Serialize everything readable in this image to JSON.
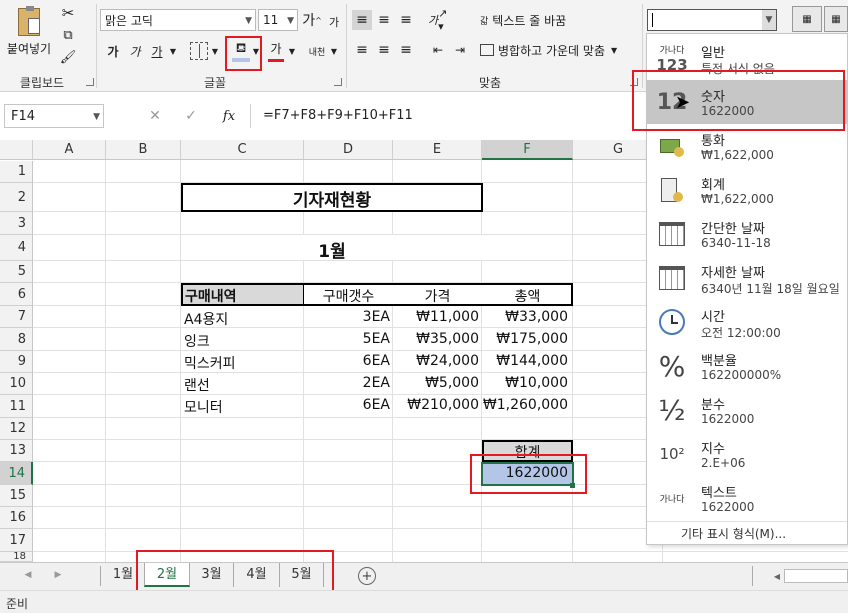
{
  "ribbon": {
    "clipboard": {
      "paste_label": "붙여넣기",
      "group_label": "클립보드"
    },
    "font": {
      "font_name": "맑은 고딕",
      "font_size": "11",
      "grow_label": "가",
      "shrink_label": "가",
      "bold_label": "가",
      "italic_label": "가",
      "underline_label": "가",
      "font_color_label": "가",
      "phonetic_label": "내천",
      "group_label": "글꼴"
    },
    "align": {
      "wrap_label": "텍스트 줄 바꿈",
      "wrap_glyph": "갋",
      "merge_label": "병합하고 가운데 맞춤",
      "orient_label": "가",
      "group_label": "맞춤"
    },
    "number": {
      "format_value": ""
    }
  },
  "formula_bar": {
    "name_box": "F14",
    "cancel": "✕",
    "enter": "✓",
    "fx": "fx",
    "formula": "=F7+F8+F9+F10+F11"
  },
  "columns": [
    "A",
    "B",
    "C",
    "D",
    "E",
    "F",
    "G"
  ],
  "rows": [
    "1",
    "2",
    "3",
    "4",
    "5",
    "6",
    "7",
    "8",
    "9",
    "10",
    "11",
    "12",
    "13",
    "14",
    "15",
    "16",
    "17",
    "18"
  ],
  "sheet": {
    "title": "기자재현황",
    "month": "1월",
    "headers": [
      "구매내역",
      "구매갯수",
      "가격",
      "총액"
    ],
    "items": [
      {
        "name": "A4용지",
        "qty": "3EA",
        "price": "₩11,000",
        "total": "₩33,000"
      },
      {
        "name": "잉크",
        "qty": "5EA",
        "price": "₩35,000",
        "total": "₩175,000"
      },
      {
        "name": "믹스커피",
        "qty": "6EA",
        "price": "₩24,000",
        "total": "₩144,000"
      },
      {
        "name": "랜선",
        "qty": "2EA",
        "price": "₩5,000",
        "total": "₩10,000"
      },
      {
        "name": "모니터",
        "qty": "6EA",
        "price": "₩210,000",
        "total": "₩1,260,000"
      }
    ],
    "sum_label": "합계",
    "sum_value": "1622000"
  },
  "number_format_menu": {
    "items": [
      {
        "title": "일반",
        "sub": "특정 서식 없음",
        "icon": "general-icon",
        "glyph_top": "가나다",
        "glyph_bottom": "123"
      },
      {
        "title": "숫자",
        "sub": "1622000",
        "icon": "number-icon",
        "glyph": "12"
      },
      {
        "title": "통화",
        "sub": "₩1,622,000",
        "icon": "currency-icon"
      },
      {
        "title": "회계",
        "sub": "₩1,622,000",
        "icon": "accounting-icon"
      },
      {
        "title": "간단한 날짜",
        "sub": "6340-11-18",
        "icon": "calendar-short-icon"
      },
      {
        "title": "자세한 날짜",
        "sub": "6340년 11월 18일 월요일",
        "icon": "calendar-long-icon"
      },
      {
        "title": "시간",
        "sub": "오전 12:00:00",
        "icon": "clock-icon"
      },
      {
        "title": "백분율",
        "sub": "162200000%",
        "icon": "percent-icon",
        "glyph": "%"
      },
      {
        "title": "분수",
        "sub": "1622000",
        "icon": "fraction-icon",
        "glyph": "½"
      },
      {
        "title": "지수",
        "sub": "2.E+06",
        "icon": "scientific-icon",
        "glyph": "10²"
      },
      {
        "title": "텍스트",
        "sub": "1622000",
        "icon": "text-icon",
        "glyph": "가나다"
      }
    ],
    "more": "기타 표시 형식(M)..."
  },
  "tabs": [
    "1월",
    "2월",
    "3월",
    "4월",
    "5월"
  ],
  "active_tab": "2월",
  "status": "준비",
  "colors": {
    "highlight": "#e21b22",
    "selected_cell": "#b4c6e7",
    "menu_hover": "#c6c6c6",
    "header_fill": "#d9d9d9",
    "tab_active": "#217346"
  }
}
